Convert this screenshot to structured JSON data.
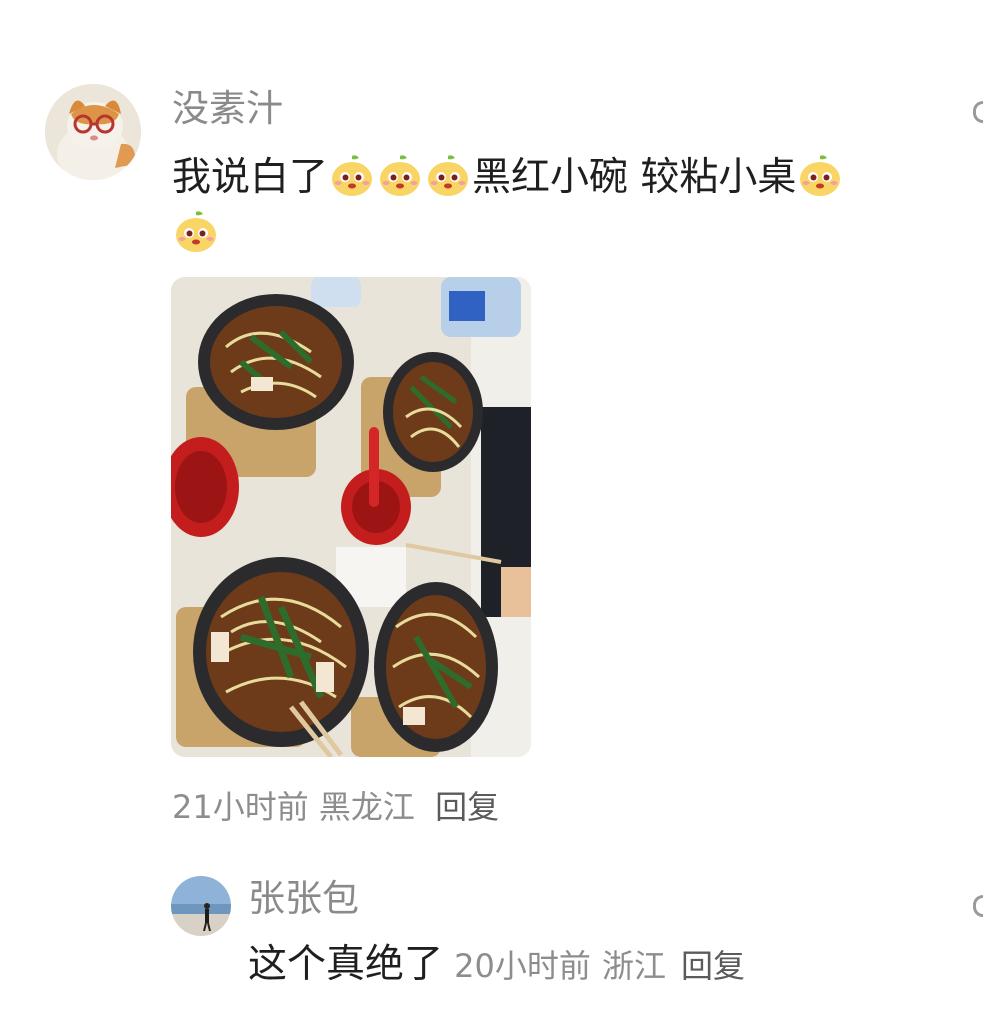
{
  "comment": {
    "username": "没素汁",
    "text_part1": "我说白了",
    "text_part2": "黑红小碗 较粘小桌",
    "emoji_name": "mango-face-emoji",
    "time": "21小时前",
    "location": "黑龙江",
    "reply_label": "回复"
  },
  "reply": {
    "username": "张张包",
    "text": "这个真绝了",
    "time": "20小时前",
    "location": "浙江",
    "reply_label": "回复"
  },
  "colors": {
    "username": "#8a8a8a",
    "text": "#1f1f1f",
    "meta": "#8d8d8d",
    "reply_action": "#5b5b5b"
  }
}
